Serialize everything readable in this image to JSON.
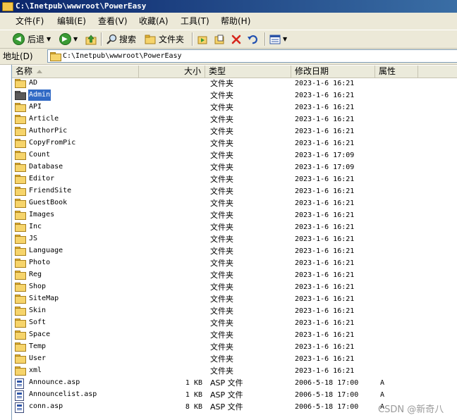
{
  "window": {
    "title": "C:\\Inetpub\\wwwroot\\PowerEasy"
  },
  "menu": [
    "文件(F)",
    "编辑(E)",
    "查看(V)",
    "收藏(A)",
    "工具(T)",
    "帮助(H)"
  ],
  "toolbar": {
    "back_label": "后退",
    "search_label": "搜索",
    "folders_label": "文件夹"
  },
  "address": {
    "label": "地址(D)",
    "value": "C:\\Inetpub\\wwwroot\\PowerEasy"
  },
  "columns": {
    "name": "名称",
    "size": "大小",
    "type": "类型",
    "date": "修改日期",
    "attr": "属性"
  },
  "files": [
    {
      "name": "AD",
      "size": "",
      "type": "文件夹",
      "date": "2023-1-6 16:21",
      "attr": "",
      "kind": "folder"
    },
    {
      "name": "Admin",
      "size": "",
      "type": "文件夹",
      "date": "2023-1-6 16:21",
      "attr": "",
      "kind": "folder",
      "selected": true
    },
    {
      "name": "API",
      "size": "",
      "type": "文件夹",
      "date": "2023-1-6 16:21",
      "attr": "",
      "kind": "folder"
    },
    {
      "name": "Article",
      "size": "",
      "type": "文件夹",
      "date": "2023-1-6 16:21",
      "attr": "",
      "kind": "folder"
    },
    {
      "name": "AuthorPic",
      "size": "",
      "type": "文件夹",
      "date": "2023-1-6 16:21",
      "attr": "",
      "kind": "folder"
    },
    {
      "name": "CopyFromPic",
      "size": "",
      "type": "文件夹",
      "date": "2023-1-6 16:21",
      "attr": "",
      "kind": "folder"
    },
    {
      "name": "Count",
      "size": "",
      "type": "文件夹",
      "date": "2023-1-6 17:09",
      "attr": "",
      "kind": "folder"
    },
    {
      "name": "Database",
      "size": "",
      "type": "文件夹",
      "date": "2023-1-6 17:09",
      "attr": "",
      "kind": "folder"
    },
    {
      "name": "Editor",
      "size": "",
      "type": "文件夹",
      "date": "2023-1-6 16:21",
      "attr": "",
      "kind": "folder"
    },
    {
      "name": "FriendSite",
      "size": "",
      "type": "文件夹",
      "date": "2023-1-6 16:21",
      "attr": "",
      "kind": "folder"
    },
    {
      "name": "GuestBook",
      "size": "",
      "type": "文件夹",
      "date": "2023-1-6 16:21",
      "attr": "",
      "kind": "folder"
    },
    {
      "name": "Images",
      "size": "",
      "type": "文件夹",
      "date": "2023-1-6 16:21",
      "attr": "",
      "kind": "folder"
    },
    {
      "name": "Inc",
      "size": "",
      "type": "文件夹",
      "date": "2023-1-6 16:21",
      "attr": "",
      "kind": "folder"
    },
    {
      "name": "JS",
      "size": "",
      "type": "文件夹",
      "date": "2023-1-6 16:21",
      "attr": "",
      "kind": "folder"
    },
    {
      "name": "Language",
      "size": "",
      "type": "文件夹",
      "date": "2023-1-6 16:21",
      "attr": "",
      "kind": "folder"
    },
    {
      "name": "Photo",
      "size": "",
      "type": "文件夹",
      "date": "2023-1-6 16:21",
      "attr": "",
      "kind": "folder"
    },
    {
      "name": "Reg",
      "size": "",
      "type": "文件夹",
      "date": "2023-1-6 16:21",
      "attr": "",
      "kind": "folder"
    },
    {
      "name": "Shop",
      "size": "",
      "type": "文件夹",
      "date": "2023-1-6 16:21",
      "attr": "",
      "kind": "folder"
    },
    {
      "name": "SiteMap",
      "size": "",
      "type": "文件夹",
      "date": "2023-1-6 16:21",
      "attr": "",
      "kind": "folder"
    },
    {
      "name": "Skin",
      "size": "",
      "type": "文件夹",
      "date": "2023-1-6 16:21",
      "attr": "",
      "kind": "folder"
    },
    {
      "name": "Soft",
      "size": "",
      "type": "文件夹",
      "date": "2023-1-6 16:21",
      "attr": "",
      "kind": "folder"
    },
    {
      "name": "Space",
      "size": "",
      "type": "文件夹",
      "date": "2023-1-6 16:21",
      "attr": "",
      "kind": "folder"
    },
    {
      "name": "Temp",
      "size": "",
      "type": "文件夹",
      "date": "2023-1-6 16:21",
      "attr": "",
      "kind": "folder"
    },
    {
      "name": "User",
      "size": "",
      "type": "文件夹",
      "date": "2023-1-6 16:21",
      "attr": "",
      "kind": "folder"
    },
    {
      "name": "xml",
      "size": "",
      "type": "文件夹",
      "date": "2023-1-6 16:21",
      "attr": "",
      "kind": "folder"
    },
    {
      "name": "Announce.asp",
      "size": "1 KB",
      "type": "ASP 文件",
      "date": "2006-5-18 17:00",
      "attr": "A",
      "kind": "file"
    },
    {
      "name": "Announcelist.asp",
      "size": "1 KB",
      "type": "ASP 文件",
      "date": "2006-5-18 17:00",
      "attr": "A",
      "kind": "file"
    },
    {
      "name": "conn.asp",
      "size": "8 KB",
      "type": "ASP 文件",
      "date": "2006-5-18 17:00",
      "attr": "A",
      "kind": "file"
    }
  ],
  "watermark": "CSDN @新奇八"
}
